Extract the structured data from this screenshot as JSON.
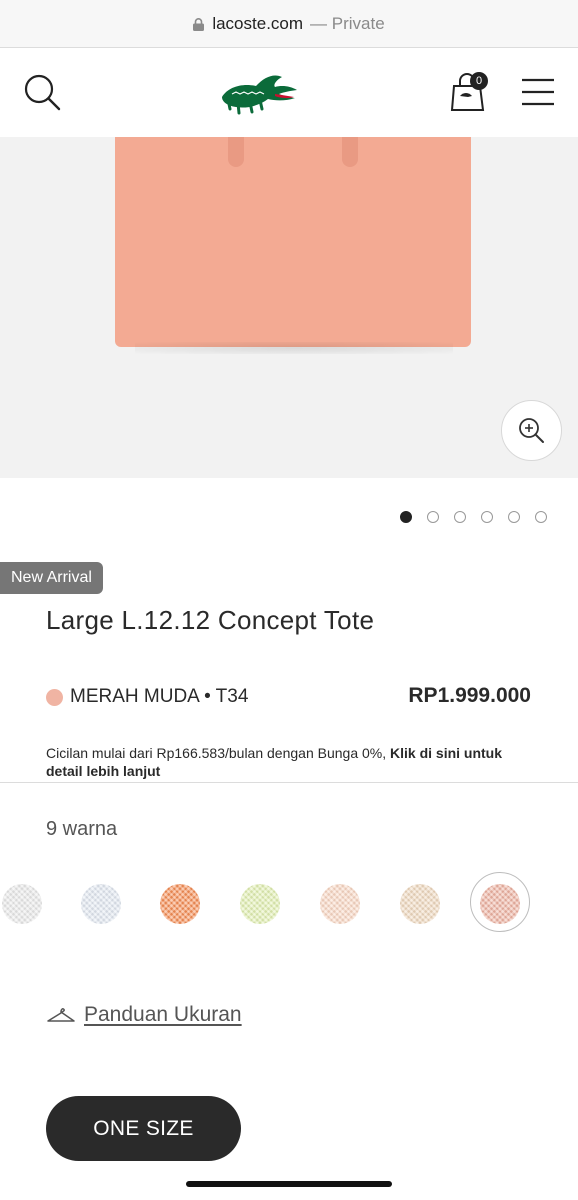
{
  "browser": {
    "domain": "lacoste.com",
    "mode": "— Private"
  },
  "header": {
    "search_icon": "search-icon",
    "logo": "lacoste-crocodile-logo",
    "cart_icon": "shopping-bag-icon",
    "cart_count": "0",
    "menu_icon": "hamburger-menu-icon"
  },
  "gallery": {
    "zoom_icon": "zoom-in-icon",
    "slide_count": 6,
    "active_slide": 1
  },
  "product": {
    "badge": "New Arrival",
    "title": "Large L.12.12 Concept Tote",
    "color_name": "MERAH MUDA • T34",
    "color_hex": "#f0b4a3",
    "price": "RP1.999.000",
    "installment_text": "Cicilan mulai dari Rp166.583/bulan dengan Bunga 0%, ",
    "installment_link": "Klik di sini untuk detail lebih lanjut"
  },
  "colors": {
    "count_label": "9 warna",
    "swatches": [
      {
        "hex": "#ebebeb"
      },
      {
        "hex": "#e3e9f2"
      },
      {
        "hex": "#f78f56"
      },
      {
        "hex": "#e3f1b3"
      },
      {
        "hex": "#fbd9c5"
      },
      {
        "hex": "#f1dac0"
      },
      {
        "hex": "#f0b4a3",
        "selected": true
      }
    ]
  },
  "size_guide": {
    "icon": "hanger-icon",
    "label": "Panduan Ukuran"
  },
  "size_button": {
    "label": "ONE SIZE"
  }
}
